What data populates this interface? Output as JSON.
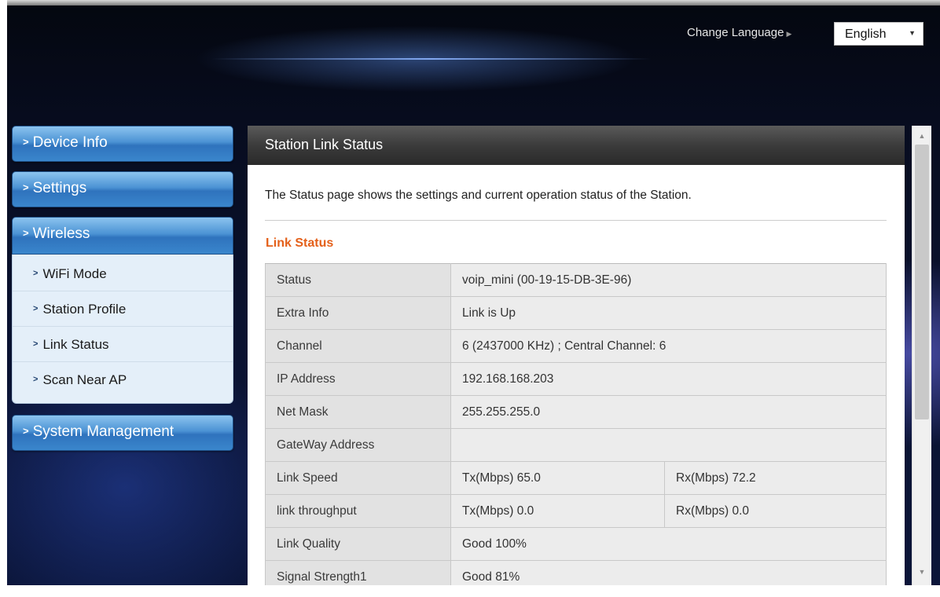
{
  "header": {
    "change_language_label": "Change Language",
    "language_selected": "English"
  },
  "sidebar": {
    "items": [
      {
        "label": "Device Info"
      },
      {
        "label": "Settings"
      },
      {
        "label": "Wireless",
        "expanded": true
      },
      {
        "label": "System Management"
      }
    ],
    "wireless_subitems": [
      {
        "label": "WiFi Mode"
      },
      {
        "label": "Station Profile"
      },
      {
        "label": "Link Status"
      },
      {
        "label": "Scan Near AP"
      }
    ]
  },
  "panel": {
    "title": "Station Link Status",
    "intro": "The Status page shows the settings and current operation status of the Station.",
    "section_title": "Link Status",
    "rows": [
      {
        "label": "Status",
        "value": "voip_mini (00-19-15-DB-3E-96)"
      },
      {
        "label": "Extra Info",
        "value": "Link is Up"
      },
      {
        "label": "Channel",
        "value": "6 (2437000 KHz) ; Central Channel: 6"
      },
      {
        "label": "IP Address",
        "value": "192.168.168.203"
      },
      {
        "label": "Net Mask",
        "value": "255.255.255.0"
      },
      {
        "label": "GateWay Address",
        "value": ""
      },
      {
        "label": "Link Speed",
        "tx": "Tx(Mbps)  65.0",
        "rx": "Rx(Mbps)  72.2"
      },
      {
        "label": "link throughput",
        "tx": "Tx(Mbps)  0.0",
        "rx": "Rx(Mbps)  0.0"
      },
      {
        "label": "Link Quality",
        "value": "Good 100%"
      },
      {
        "label": "Signal Strength1",
        "value": "Good 81%"
      }
    ]
  },
  "colors": {
    "section_title": "#e4601a",
    "menu_blue": "#3a86cc",
    "header_dark": "#3b3b3b"
  }
}
